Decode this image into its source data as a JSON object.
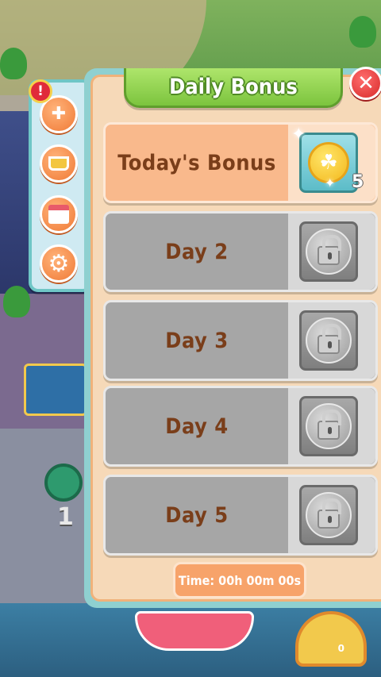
{
  "dialog": {
    "title": "Daily Bonus",
    "close_icon": "close-icon"
  },
  "side_menu": {
    "alert_badge": "!",
    "items": [
      {
        "name": "plus-icon",
        "glyph": "✚"
      },
      {
        "name": "basket-icon",
        "glyph": ""
      },
      {
        "name": "shop-icon",
        "glyph": ""
      },
      {
        "name": "gear-icon",
        "glyph": "⚙"
      }
    ]
  },
  "days": [
    {
      "label": "Today's Bonus",
      "state": "today",
      "reward_icon": "clover-coin-icon",
      "reward_count": "5"
    },
    {
      "label": "Day 2",
      "state": "locked",
      "reward_icon": "lock-icon"
    },
    {
      "label": "Day 3",
      "state": "locked",
      "reward_icon": "lock-icon"
    },
    {
      "label": "Day 4",
      "state": "locked",
      "reward_icon": "lock-icon"
    },
    {
      "label": "Day 5",
      "state": "locked",
      "reward_icon": "lock-icon"
    }
  ],
  "timer": {
    "text": "Time: 00h 00m 00s"
  },
  "background": {
    "level_number": "1",
    "wheel_count": "0"
  }
}
